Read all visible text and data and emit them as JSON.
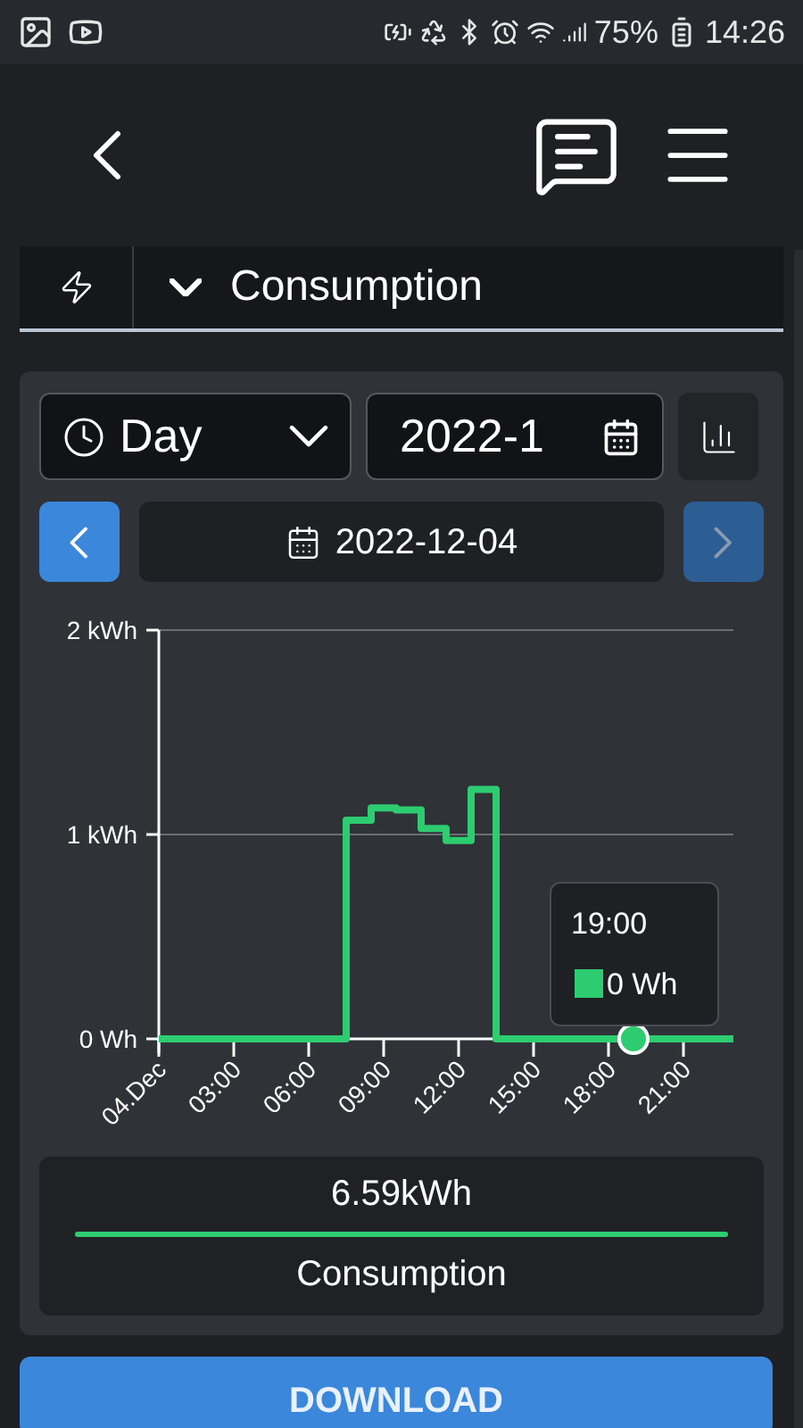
{
  "status_bar": {
    "battery": "75%",
    "time": "14:26"
  },
  "section": {
    "title": "Consumption",
    "expanded": true
  },
  "controls": {
    "period": "Day",
    "date_field": "2022-1",
    "date": "2022-12-04",
    "prev_disabled": false,
    "next_disabled": true
  },
  "chart_data": {
    "type": "line",
    "x": [
      0,
      7.5,
      7.5,
      8.5,
      8.5,
      9.5,
      9.5,
      10.5,
      10.5,
      11.5,
      11.5,
      12.5,
      12.5,
      13.5,
      13.5,
      23
    ],
    "series": [
      {
        "name": "Consumption",
        "color": "#2ecc71",
        "values": [
          0,
          0,
          1.07,
          1.07,
          1.13,
          1.13,
          1.12,
          1.12,
          1.03,
          1.03,
          0.97,
          0.97,
          1.22,
          1.22,
          0,
          0
        ]
      }
    ],
    "xlim": [
      0,
      23
    ],
    "ylim": [
      0,
      2
    ],
    "xticks": [
      {
        "value": 0,
        "label": "04.Dec"
      },
      {
        "value": 3,
        "label": "03:00"
      },
      {
        "value": 6,
        "label": "06:00"
      },
      {
        "value": 9,
        "label": "09:00"
      },
      {
        "value": 12,
        "label": "12:00"
      },
      {
        "value": 15,
        "label": "15:00"
      },
      {
        "value": 18,
        "label": "18:00"
      },
      {
        "value": 21,
        "label": "21:00"
      }
    ],
    "yticks": [
      {
        "value": 0,
        "label": "0 Wh"
      },
      {
        "value": 1,
        "label": "1 kWh"
      },
      {
        "value": 2,
        "label": "2 kWh"
      }
    ]
  },
  "tooltip": {
    "title": "19:00",
    "value": "0 Wh",
    "color": "#2ecc71"
  },
  "summary": {
    "value": "6.59kWh"
  },
  "download": "DOWNLOAD"
}
